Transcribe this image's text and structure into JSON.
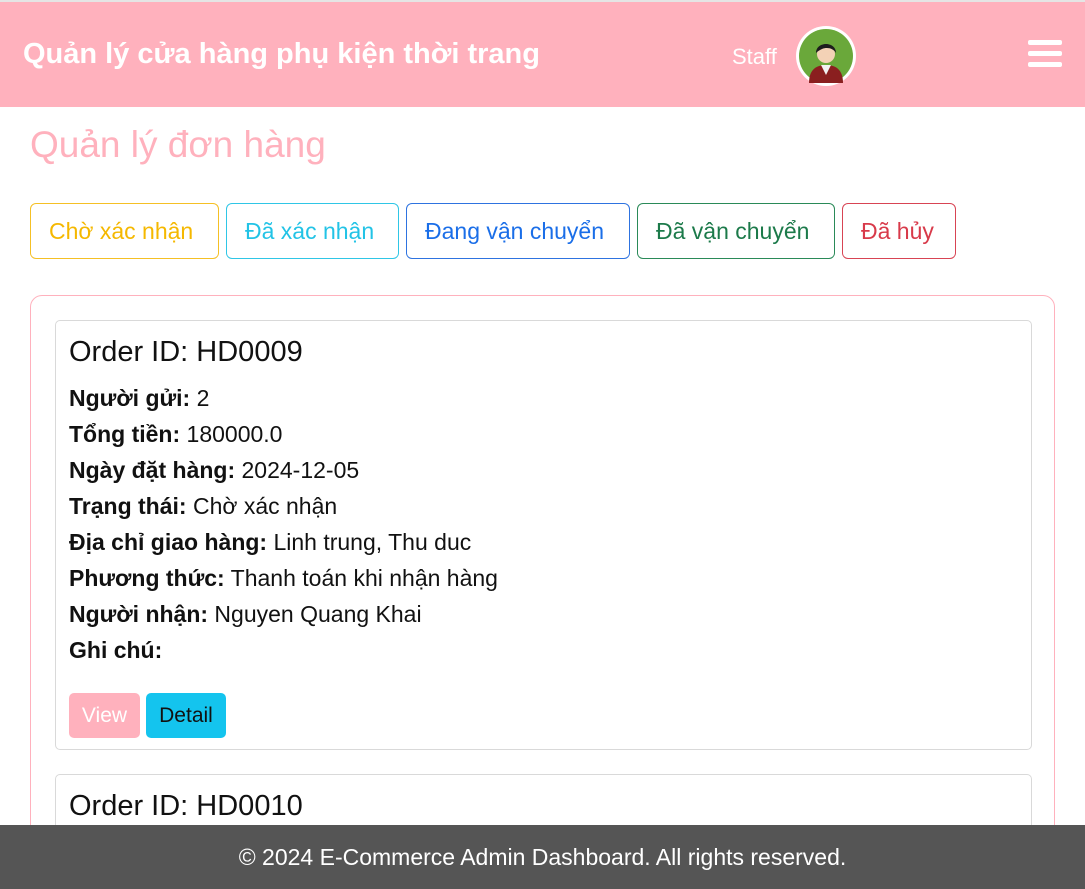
{
  "header": {
    "app_title": "Quản lý cửa hàng phụ kiện thời trang",
    "role_label": "Staff",
    "avatar_icon": "user-avatar-icon",
    "menu_icon": "hamburger-menu-icon",
    "background_color": "#ffb1bd"
  },
  "page": {
    "title": "Quản lý đơn hàng"
  },
  "tabs": [
    {
      "label": "Chờ xác nhận",
      "color": "#f5b800"
    },
    {
      "label": "Đã xác nhận",
      "color": "#22c3e6"
    },
    {
      "label": "Đang vận chuyển",
      "color": "#1a6ee8"
    },
    {
      "label": "Đã vận chuyển",
      "color": "#1c7a4a"
    },
    {
      "label": "Đã hủy",
      "color": "#d83a4a"
    }
  ],
  "orders": [
    {
      "order_id": "Order ID: HD0009",
      "fields": [
        {
          "label": "Người gửi:",
          "value": " 2"
        },
        {
          "label": "Tổng tiền:",
          "value": " 180000.0"
        },
        {
          "label": "Ngày đặt hàng:",
          "value": " 2024-12-05"
        },
        {
          "label": "Trạng thái:",
          "value": " Chờ xác nhận"
        },
        {
          "label": "Địa chỉ giao hàng:",
          "value": " Linh trung, Thu duc"
        },
        {
          "label": "Phương thức:",
          "value": " Thanh toán khi nhận hàng"
        },
        {
          "label": "Người nhận:",
          "value": " Nguyen Quang Khai"
        },
        {
          "label": "Ghi chú:",
          "value": ""
        }
      ],
      "buttons": {
        "view": "View",
        "detail": "Detail"
      }
    },
    {
      "order_id": "Order ID: HD0010"
    }
  ],
  "footer": {
    "text": "© 2024 E-Commerce Admin Dashboard. All rights reserved."
  }
}
